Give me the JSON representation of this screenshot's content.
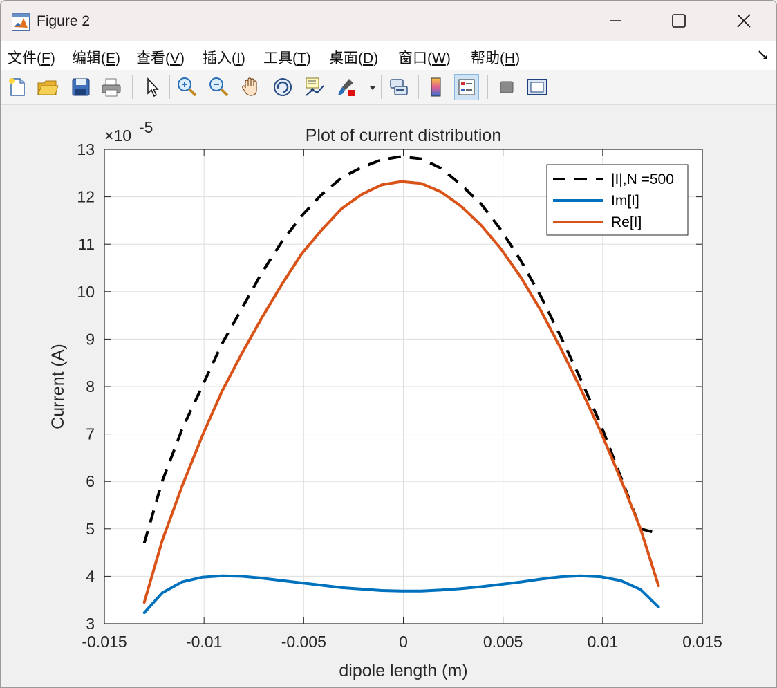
{
  "window": {
    "title": "Figure 2"
  },
  "menu": [
    {
      "label": "文件(",
      "key": "F",
      "suffix": ")"
    },
    {
      "label": "编辑(",
      "key": "E",
      "suffix": ")"
    },
    {
      "label": "查看(",
      "key": "V",
      "suffix": ")"
    },
    {
      "label": "插入(",
      "key": "I",
      "suffix": ")"
    },
    {
      "label": "工具(",
      "key": "T",
      "suffix": ")"
    },
    {
      "label": "桌面(",
      "key": "D",
      "suffix": ")"
    },
    {
      "label": "窗口(",
      "key": "W",
      "suffix": ")"
    },
    {
      "label": "帮助(",
      "key": "H",
      "suffix": ")"
    }
  ],
  "toolbar": {
    "icons": [
      "new-figure-icon",
      "open-file-icon",
      "save-icon",
      "print-icon",
      "pointer-icon",
      "zoom-in-icon",
      "zoom-out-icon",
      "pan-hand-icon",
      "rotate-3d-icon",
      "data-cursor-icon",
      "brush-icon",
      "link-plot-icon",
      "colorbar-icon",
      "legend-icon",
      "hide-plot-tools-icon",
      "show-plot-tools-icon"
    ]
  },
  "chart_data": {
    "type": "line",
    "title": "Plot of current distribution",
    "xlabel": "dipole length (m)",
    "ylabel": "Current (A)",
    "exponent_label": "×10",
    "exponent_power": "-5",
    "xlim": [
      -0.015,
      0.015
    ],
    "ylim": [
      3,
      13
    ],
    "xticks": [
      -0.015,
      -0.01,
      -0.005,
      0,
      0.005,
      0.01,
      0.015
    ],
    "xtick_labels": [
      "-0.015",
      "-0.01",
      "-0.005",
      "0",
      "0.005",
      "0.01",
      "0.015"
    ],
    "yticks": [
      3,
      4,
      5,
      6,
      7,
      8,
      9,
      10,
      11,
      12,
      13
    ],
    "ytick_labels": [
      "3",
      "4",
      "5",
      "6",
      "7",
      "8",
      "9",
      "10",
      "11",
      "12",
      "13"
    ],
    "grid": true,
    "legend_position": "top-right",
    "x": [
      -0.013,
      -0.0121,
      -0.0111,
      -0.0101,
      -0.0091,
      -0.0081,
      -0.0071,
      -0.0061,
      -0.0051,
      -0.0041,
      -0.0031,
      -0.0021,
      -0.0011,
      -0.0001,
      0.0009,
      0.0019,
      0.0029,
      0.0039,
      0.0049,
      0.0059,
      0.0069,
      0.0079,
      0.0089,
      0.0099,
      0.0109,
      0.0119,
      0.0128
    ],
    "series": [
      {
        "name": "|I|,N =500",
        "color": "#000000",
        "style": "dashed",
        "values": [
          4.7,
          6.0,
          7.1,
          8.0,
          8.9,
          9.65,
          10.4,
          11.05,
          11.6,
          12.05,
          12.4,
          12.62,
          12.78,
          12.85,
          12.8,
          12.6,
          12.25,
          11.85,
          11.3,
          10.65,
          9.9,
          9.05,
          8.15,
          7.2,
          6.1,
          5.0,
          4.9
        ]
      },
      {
        "name": "Im[I]",
        "color": "#0072bd",
        "style": "solid",
        "values": [
          3.23,
          3.65,
          3.88,
          3.98,
          4.01,
          4.0,
          3.96,
          3.91,
          3.86,
          3.81,
          3.76,
          3.73,
          3.7,
          3.69,
          3.69,
          3.71,
          3.74,
          3.78,
          3.83,
          3.88,
          3.94,
          3.99,
          4.01,
          3.99,
          3.91,
          3.72,
          3.35
        ]
      },
      {
        "name": "Re[I]",
        "color": "#d95319",
        "style": "solid",
        "values": [
          3.45,
          4.75,
          5.9,
          6.95,
          7.9,
          8.7,
          9.45,
          10.15,
          10.8,
          11.3,
          11.75,
          12.05,
          12.25,
          12.32,
          12.28,
          12.1,
          11.8,
          11.4,
          10.9,
          10.3,
          9.6,
          8.8,
          7.95,
          7.05,
          6.05,
          5.0,
          3.8
        ]
      }
    ]
  }
}
